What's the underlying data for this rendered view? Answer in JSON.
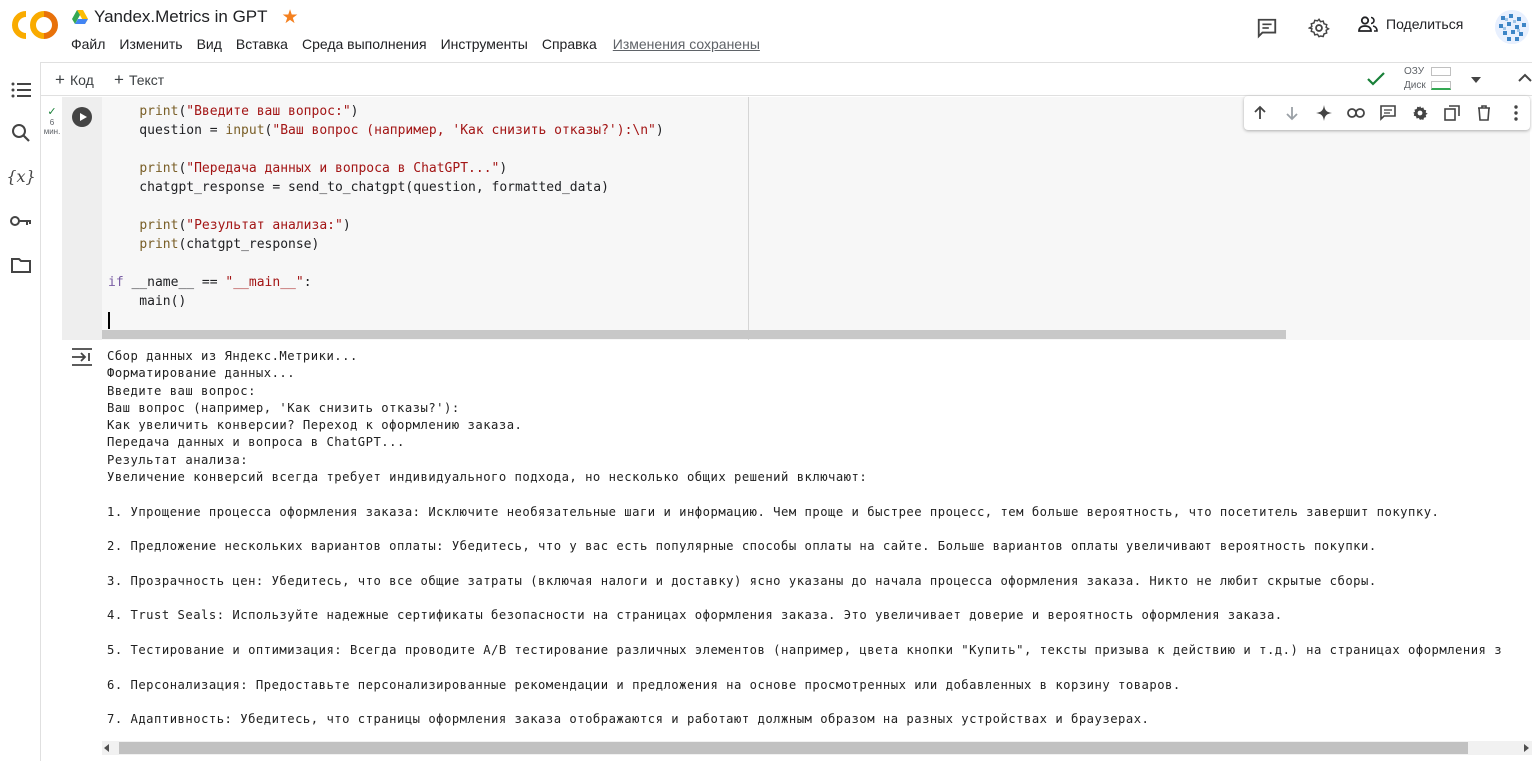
{
  "header": {
    "title": "Yandex.Metrics in GPT",
    "menu": [
      "Файл",
      "Изменить",
      "Вид",
      "Вставка",
      "Среда выполнения",
      "Инструменты",
      "Справка"
    ],
    "saved_status": "Изменения сохранены",
    "share_label": "Поделиться",
    "icons": [
      "comment-icon",
      "gear-icon",
      "people-icon"
    ],
    "star_color": "#f4801f"
  },
  "toolbar": {
    "add_code_label": "Код",
    "add_text_label": "Текст",
    "ram_label": "ОЗУ",
    "disk_label": "Диск"
  },
  "cell": {
    "exec_time_line1": "6",
    "exec_time_line2": "мин.",
    "code_lines": [
      [
        [
          "    ",
          "pl"
        ],
        [
          "print",
          "fn"
        ],
        [
          "(",
          "pl"
        ],
        [
          "\"Введите ваш вопрос:\"",
          "str"
        ],
        [
          ")",
          "pl"
        ]
      ],
      [
        [
          "    question = ",
          "pl"
        ],
        [
          "input",
          "fn"
        ],
        [
          "(",
          "pl"
        ],
        [
          "\"Ваш вопрос (например, 'Как снизить отказы?'):\\n\"",
          "str"
        ],
        [
          ")",
          "pl"
        ]
      ],
      [
        [
          "",
          "pl"
        ]
      ],
      [
        [
          "    ",
          "pl"
        ],
        [
          "print",
          "fn"
        ],
        [
          "(",
          "pl"
        ],
        [
          "\"Передача данных и вопроса в ChatGPT...\"",
          "str"
        ],
        [
          ")",
          "pl"
        ]
      ],
      [
        [
          "    chatgpt_response = send_to_chatgpt(question, formatted_data)",
          "pl"
        ]
      ],
      [
        [
          "",
          "pl"
        ]
      ],
      [
        [
          "    ",
          "pl"
        ],
        [
          "print",
          "fn"
        ],
        [
          "(",
          "pl"
        ],
        [
          "\"Результат анализа:\"",
          "str"
        ],
        [
          ")",
          "pl"
        ]
      ],
      [
        [
          "    ",
          "pl"
        ],
        [
          "print",
          "fn"
        ],
        [
          "(chatgpt_response)",
          "pl"
        ]
      ],
      [
        [
          "",
          "pl"
        ]
      ],
      [
        [
          "if",
          "kw"
        ],
        [
          " __name__ == ",
          "pl"
        ],
        [
          "\"__main__\"",
          "str"
        ],
        [
          ":",
          "pl"
        ]
      ],
      [
        [
          "    main()",
          "pl"
        ]
      ]
    ]
  },
  "output": {
    "lines": [
      "Сбор данных из Яндекс.Метрики...",
      "Форматирование данных...",
      "Введите ваш вопрос:",
      "Ваш вопрос (например, 'Как снизить отказы?'):",
      "Как увеличить конверсии? Переход к оформлению заказа.",
      "Передача данных и вопроса в ChatGPT...",
      "Результат анализа:",
      "Увеличение конверсий всегда требует индивидуального подхода, но несколько общих решений включают:",
      "",
      "1. Упрощение процесса оформления заказа: Исключите необязательные шаги и информацию. Чем проще и быстрее процесс, тем больше вероятность, что посетитель завершит покупку.",
      "",
      "2. Предложение нескольких вариантов оплаты: Убедитесь, что у вас есть популярные способы оплаты на сайте. Больше вариантов оплаты увеличивают вероятность покупки.",
      "",
      "3. Прозрачность цен: Убедитесь, что все общие затраты (включая налоги и доставку) ясно указаны до начала процесса оформления заказа. Никто не любит скрытые сборы.",
      "",
      "4. Trust Seals: Используйте надежные сертификаты безопасности на страницах оформления заказа. Это увеличивает доверие и вероятность оформления заказа.",
      "",
      "5. Тестирование и оптимизация: Всегда проводите A/B тестирование различных элементов (например, цвета кнопки \"Купить\", тексты призыва к действию и т.д.) на страницах оформления з",
      "",
      "6. Персонализация: Предоставьте персонализированные рекомендации и предложения на основе просмотренных или добавленных в корзину товаров.",
      "",
      "7. Адаптивность: Убедитесь, что страницы оформления заказа отображаются и работают должным образом на разных устройствах и браузерах."
    ]
  }
}
